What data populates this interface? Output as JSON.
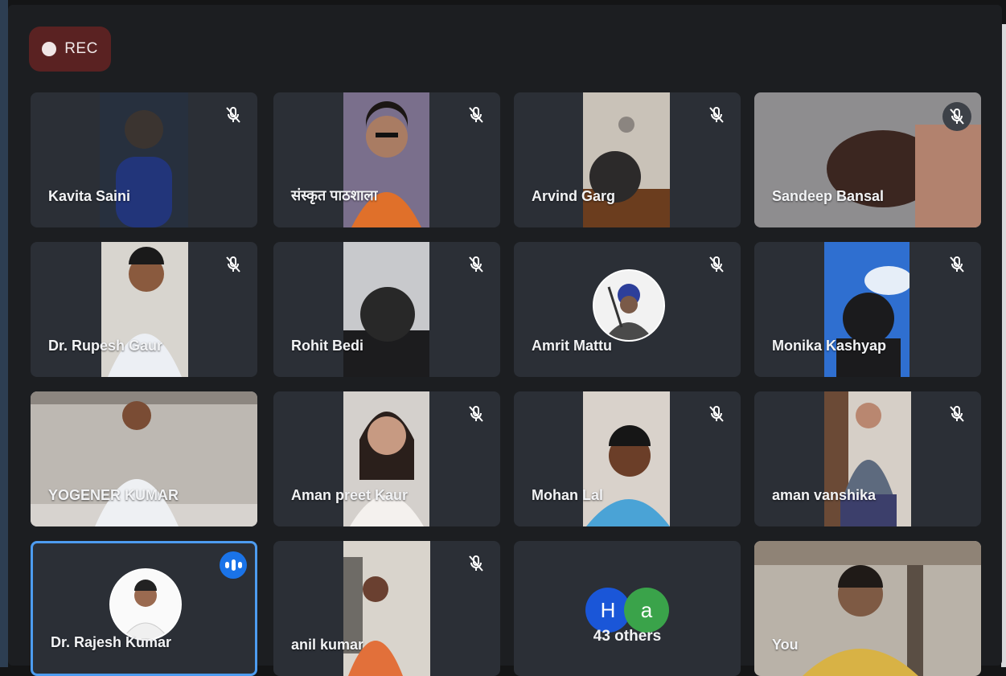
{
  "recording": {
    "label": "REC"
  },
  "participants": [
    {
      "name": "Kavita Saini",
      "muted": true
    },
    {
      "name": "संस्कृत पाठशाला",
      "muted": true
    },
    {
      "name": "Arvind Garg",
      "muted": true
    },
    {
      "name": "Sandeep Bansal",
      "muted": true
    },
    {
      "name": "Dr. Rupesh Gaur",
      "muted": true
    },
    {
      "name": "Rohit Bedi",
      "muted": true
    },
    {
      "name": "Amrit Mattu",
      "muted": true
    },
    {
      "name": "Monika Kashyap",
      "muted": true
    },
    {
      "name": "YOGENER KUMAR",
      "muted": false
    },
    {
      "name": "Aman preet Kaur",
      "muted": true
    },
    {
      "name": "Mohan Lal",
      "muted": true
    },
    {
      "name": "aman vanshika",
      "muted": true
    },
    {
      "name": "Dr. Rajesh Kumar",
      "muted": false,
      "speaking": true
    },
    {
      "name": "anil kumar",
      "muted": true
    },
    {
      "name": "43 others",
      "initials": [
        "H",
        "a"
      ],
      "bubble_colors": [
        "#1a56d8",
        "#3aa34a"
      ]
    },
    {
      "name": "You",
      "muted": false
    }
  ],
  "colors": {
    "tile_bg": "#2b2f36",
    "active_border": "#4d9cf0",
    "rec_bg": "#5a2222"
  }
}
